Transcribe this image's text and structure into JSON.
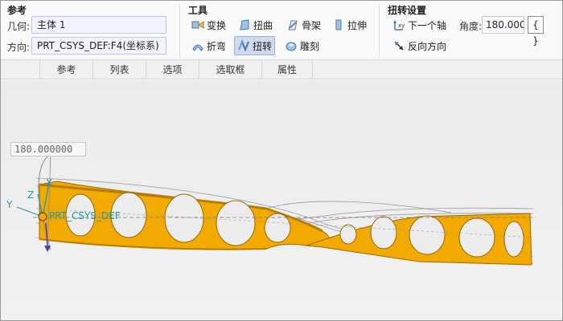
{
  "reference_group": {
    "title": "参考",
    "geometry_label": "几何:",
    "geometry_value": "主体 1",
    "direction_label": "方向:",
    "direction_value": "PRT_CSYS_DEF:F4(坐标系)"
  },
  "tools_group": {
    "title": "工具",
    "items": [
      {
        "label": "变换",
        "icon": "transform-icon",
        "active": false
      },
      {
        "label": "扭曲",
        "icon": "warp-icon",
        "active": false
      },
      {
        "label": "骨架",
        "icon": "skeleton-icon",
        "active": false
      },
      {
        "label": "拉伸",
        "icon": "stretch-icon",
        "active": false
      },
      {
        "label": "折弯",
        "icon": "bend-icon",
        "active": false
      },
      {
        "label": "扭转",
        "icon": "twist-icon",
        "active": true
      },
      {
        "label": "雕刻",
        "icon": "sculpt-icon",
        "active": false
      }
    ]
  },
  "twist_settings": {
    "title": "扭转设置",
    "next_axis_label": "下一个轴",
    "reverse_label": "反向方向",
    "angle_label": "角度:",
    "angle_value": "180.000(",
    "brace_label": "{ }"
  },
  "tabs": [
    "参考",
    "列表",
    "选项",
    "选取框",
    "属性"
  ],
  "viewport": {
    "dimension_value": "180.000000",
    "csys_name": "PRT_CSYS_DEF",
    "axis_x": "X",
    "axis_y": "Y",
    "axis_z": "Z"
  },
  "colors": {
    "part_fill": "#f2a900",
    "part_edge": "#9a6a00",
    "active_tool_bg": "#cfd9ef",
    "csys_teal": "#1f9aa0"
  }
}
